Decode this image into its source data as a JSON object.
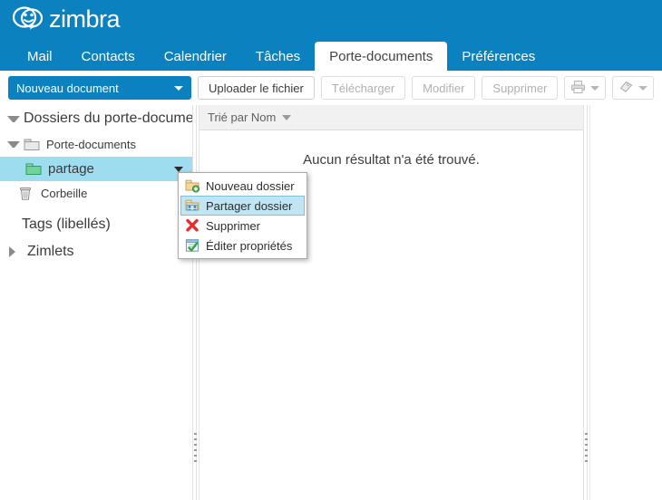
{
  "brand": {
    "name": "zimbra",
    "logo_icon": "zimbra-smiley-logo",
    "banner_color": "#0c81c0"
  },
  "tabs": [
    {
      "label": "Mail",
      "name": "tab-mail",
      "active": false
    },
    {
      "label": "Contacts",
      "name": "tab-contacts",
      "active": false
    },
    {
      "label": "Calendrier",
      "name": "tab-calendrier",
      "active": false
    },
    {
      "label": "Tâches",
      "name": "tab-taches",
      "active": false
    },
    {
      "label": "Porte-documents",
      "name": "tab-porte-documents",
      "active": true
    },
    {
      "label": "Préférences",
      "name": "tab-preferences",
      "active": false
    }
  ],
  "toolbar": {
    "new_document_label": "Nouveau document",
    "upload_label": "Uploader le fichier",
    "download_label": "Télécharger",
    "edit_label": "Modifier",
    "delete_label": "Supprimer",
    "print_icon": "printer-icon",
    "tag_icon": "tag-icon"
  },
  "sidebar": {
    "header": {
      "label": "Dossiers du porte-documents",
      "expanded": true
    },
    "items": [
      {
        "label": "Porte-documents",
        "icon": "folder-icon-gray",
        "indent": 1,
        "expanded": true,
        "selected": false
      },
      {
        "label": "partage",
        "icon": "folder-icon-green",
        "indent": 2,
        "expanded": false,
        "selected": true
      },
      {
        "label": "Corbeille",
        "icon": "trash-icon",
        "indent": 2,
        "expanded": false,
        "selected": false
      }
    ],
    "tags_label": "Tags (libellés)",
    "zimlets_label": "Zimlets",
    "selected_color": "#9edcef"
  },
  "content": {
    "sort_label": "Trié par Nom",
    "empty_message": "Aucun résultat n'a été trouvé."
  },
  "context_menu": {
    "items": [
      {
        "label": "Nouveau dossier",
        "icon": "folder-add-icon",
        "selected": false
      },
      {
        "label": "Partager dossier",
        "icon": "folder-share-icon",
        "selected": true
      },
      {
        "label": "Supprimer",
        "icon": "delete-x-icon",
        "selected": false
      },
      {
        "label": "Éditer propriétés",
        "icon": "edit-properties-icon",
        "selected": false
      }
    ]
  }
}
